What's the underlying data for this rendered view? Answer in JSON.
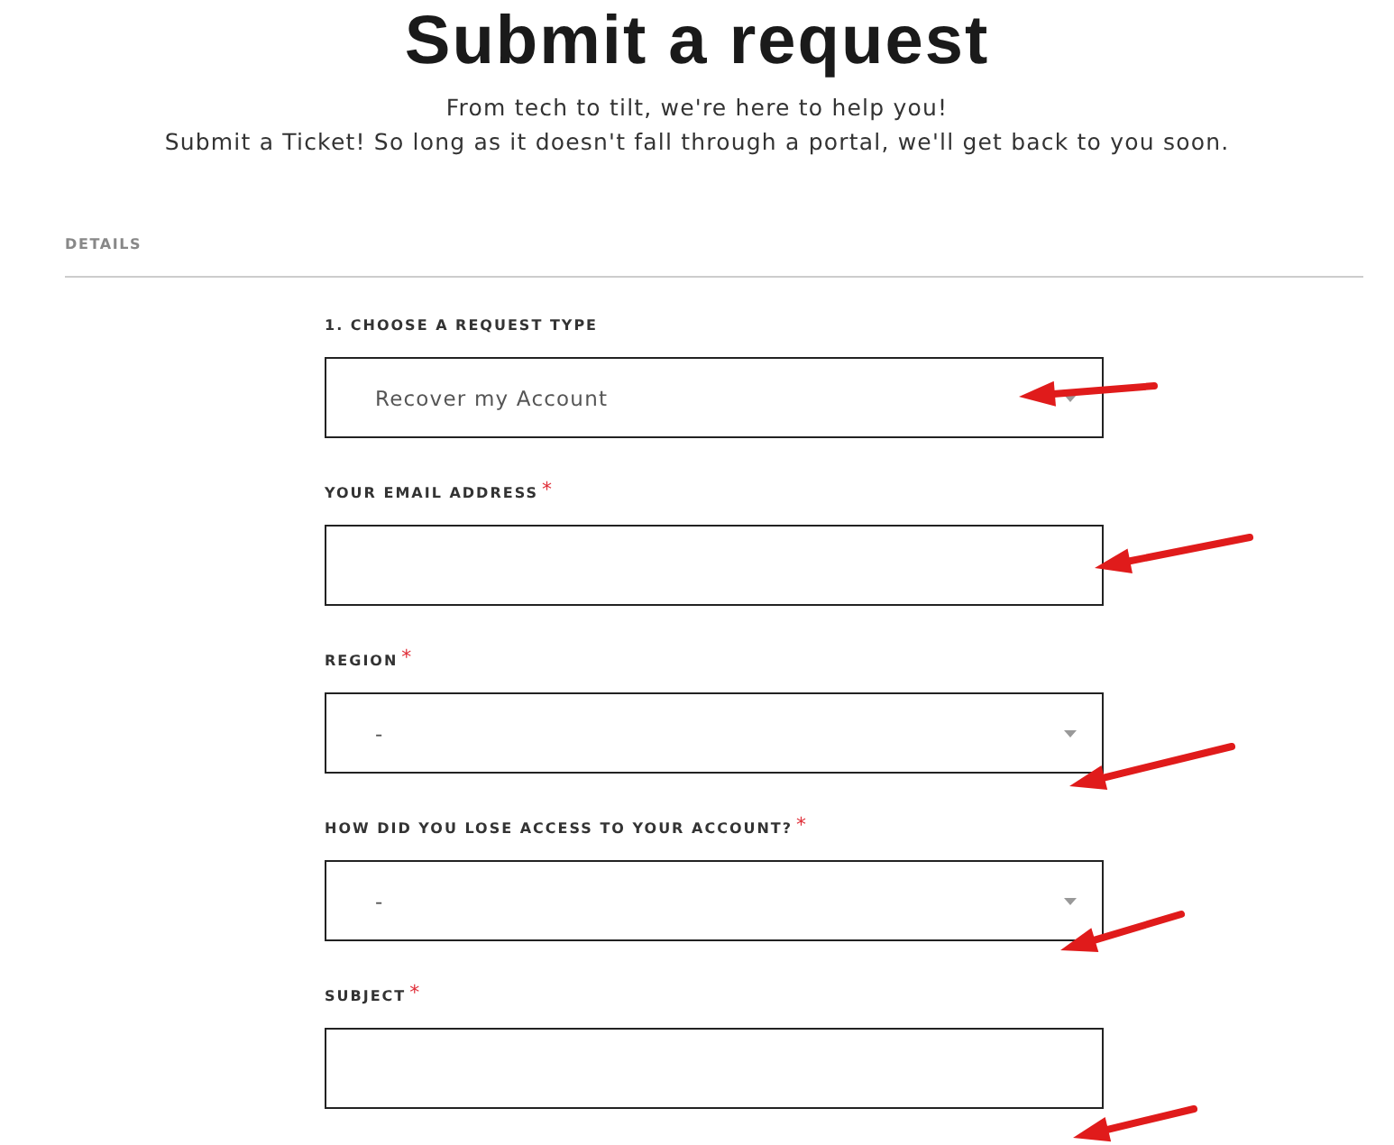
{
  "header": {
    "title": "Submit a request",
    "subtitle_lines": [
      "From tech to tilt, we're here to help you!",
      "Submit a Ticket! So long as it doesn't fall through a portal, we'll get back to you soon."
    ]
  },
  "section": {
    "title": "DETAILS"
  },
  "fields": [
    {
      "kind": "select",
      "label": "1. CHOOSE A REQUEST TYPE",
      "value": "Recover my Account"
    },
    {
      "kind": "text",
      "label": "YOUR EMAIL ADDRESS",
      "required_mark": "*"
    },
    {
      "kind": "select",
      "label": "REGION",
      "required_mark": "*",
      "value": "-"
    },
    {
      "kind": "select",
      "label": "HOW DID YOU LOSE ACCESS TO YOUR ACCOUNT?",
      "required_mark": "*",
      "value": "-"
    },
    {
      "kind": "text",
      "label": "SUBJECT",
      "required_mark": "*"
    }
  ]
}
